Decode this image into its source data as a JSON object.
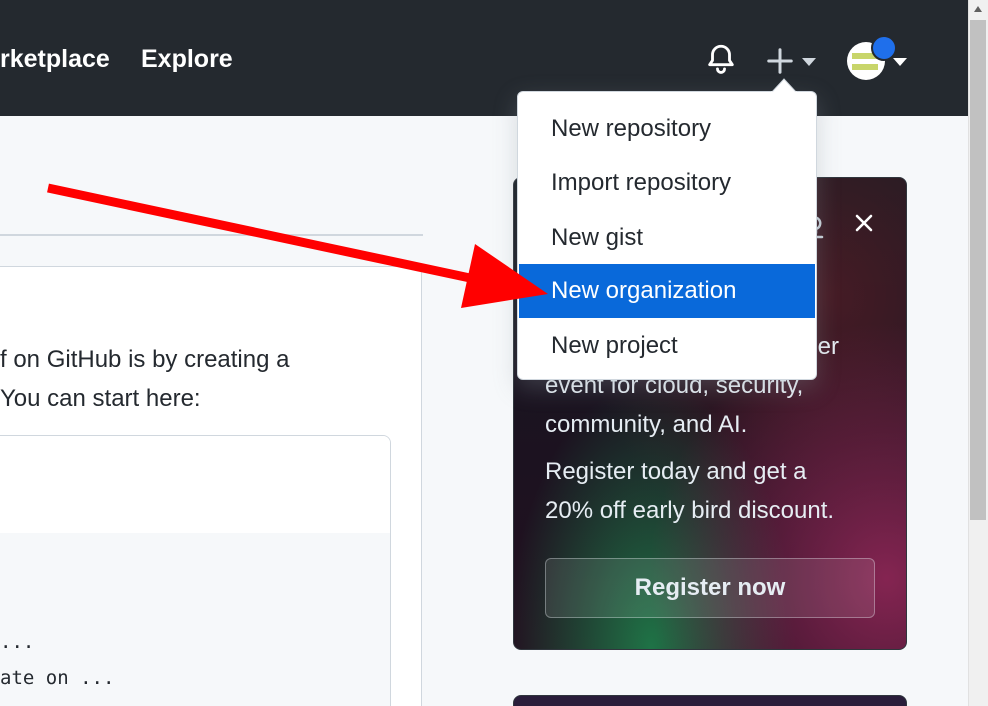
{
  "header": {
    "nav": {
      "marketplace": "rketplace",
      "explore": "Explore"
    },
    "icons": {
      "notifications": "bell-icon",
      "create": "plus-icon",
      "avatar": "avatar"
    }
  },
  "create_menu": {
    "items": [
      {
        "label": "New repository",
        "active": false
      },
      {
        "label": "Import repository",
        "active": false
      },
      {
        "label": "New gist",
        "active": false
      },
      {
        "label": "New organization",
        "active": true
      },
      {
        "label": "New project",
        "active": false
      }
    ]
  },
  "left": {
    "intro_lines": [
      "f on GitHub is by creating a",
      "You can start here:"
    ],
    "code_lines": [
      "...",
      "ate on ..."
    ]
  },
  "promo": {
    "lines_top": [
      "er",
      "event for cloud, security,",
      "community, and AI."
    ],
    "lines_bottom": [
      "Register today and get a",
      "20% off early bird discount."
    ],
    "button": "Register now"
  },
  "colors": {
    "header_bg": "#24292f",
    "accent": "#0969da",
    "annotation": "#ff0000"
  }
}
